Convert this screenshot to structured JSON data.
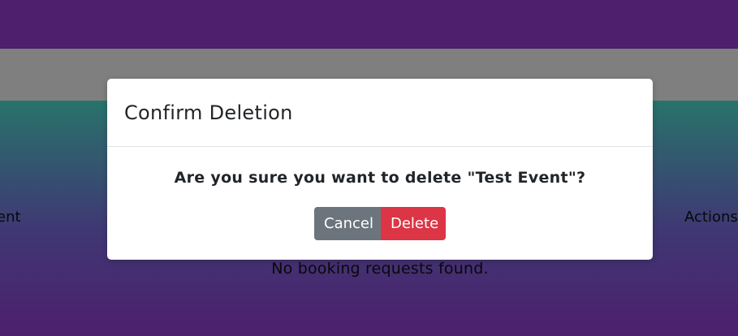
{
  "background_page": {
    "table_headers": {
      "event": "Event",
      "actions": "Actions"
    },
    "empty_message": "No booking requests found."
  },
  "modal": {
    "title": "Confirm Deletion",
    "message": "Are you sure you want to delete \"Test Event\"?",
    "cancel_label": "Cancel",
    "delete_label": "Delete"
  },
  "colors": {
    "header_purple": "#9b3fd9",
    "gradient_teal": "#52e6d6",
    "cancel_gray": "#6c757d",
    "delete_red": "#dc3545",
    "backdrop": "rgba(0,0,0,0.5)"
  }
}
